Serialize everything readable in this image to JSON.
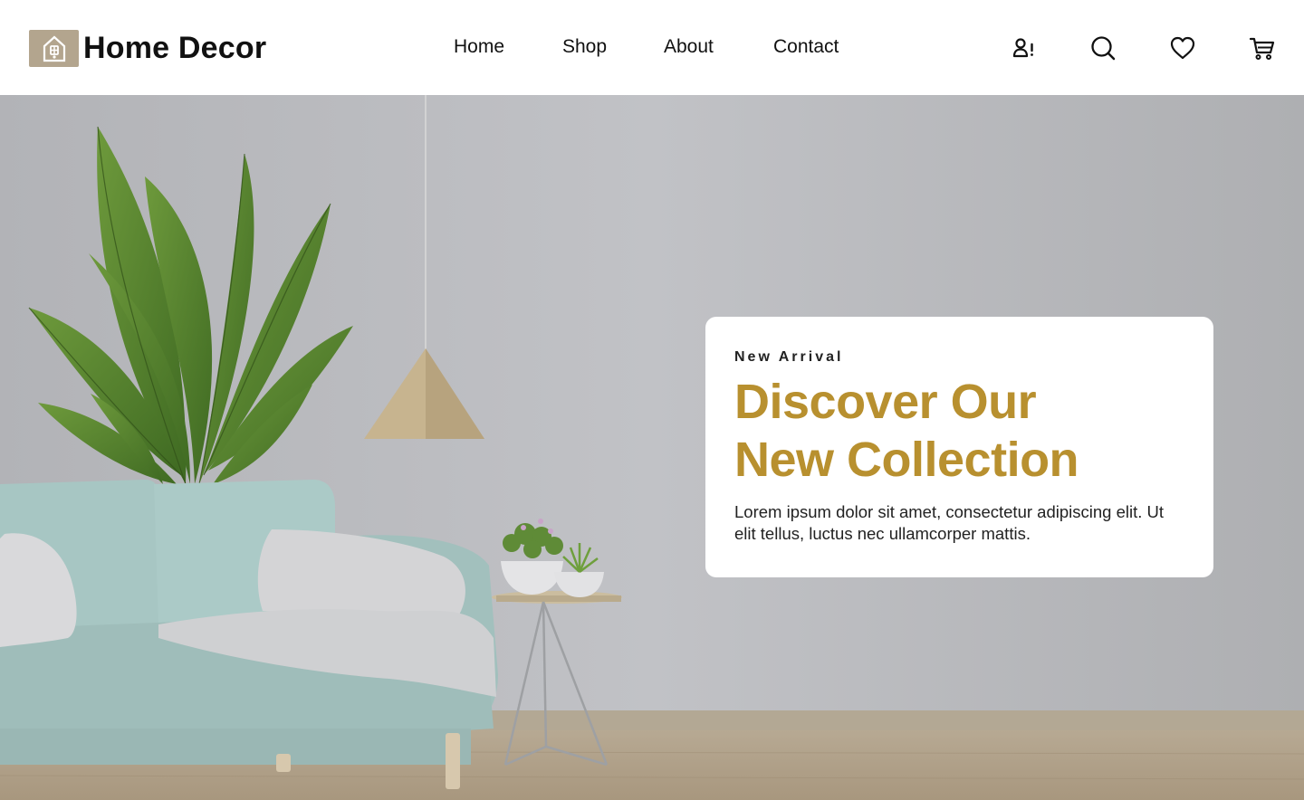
{
  "brand": {
    "name": "Home Decor",
    "logo_icon": "house-icon"
  },
  "nav": [
    {
      "label": "Home"
    },
    {
      "label": "Shop"
    },
    {
      "label": "About"
    },
    {
      "label": "Contact"
    }
  ],
  "actions": [
    {
      "name": "account-button",
      "icon": "user-alert-icon"
    },
    {
      "name": "search-button",
      "icon": "search-icon"
    },
    {
      "name": "wishlist-button",
      "icon": "heart-icon"
    },
    {
      "name": "cart-button",
      "icon": "cart-icon"
    }
  ],
  "hero": {
    "eyebrow": "New Arrival",
    "headline_line1": "Discover Our",
    "headline_line2": "New Collection",
    "body": "Lorem ipsum dolor sit amet, consectetur adipiscing elit. Ut elit tellus, luctus nec ullamcorper mattis."
  },
  "colors": {
    "accent": "#b8902f",
    "logo_bg": "#b3a58e",
    "wall": "#bbbcc0",
    "sofa": "#a9c7c4"
  }
}
